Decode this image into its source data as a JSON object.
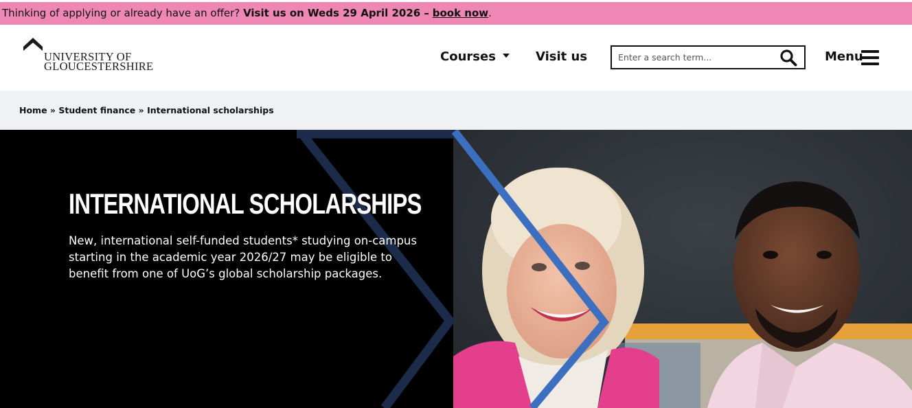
{
  "banner": {
    "lead": "Thinking of applying or already have an offer?",
    "strong": "Visit us on Weds 29 April 2026 –",
    "link": "book now",
    "end": "."
  },
  "logo": {
    "line1": "UNIVERSITY OF",
    "line2": "GLOUCESTERSHIRE"
  },
  "nav": {
    "courses": "Courses",
    "visit": "Visit us",
    "menu": "Menu"
  },
  "search": {
    "placeholder": "Enter a search term..."
  },
  "breadcrumb": {
    "home": "Home",
    "sep": "»",
    "finance": "Student finance",
    "current": "International scholarships"
  },
  "hero": {
    "title": "INTERNATIONAL SCHOLARSHIPS",
    "text": "New, international self-funded students* studying on-campus starting in the academic year 2026/27 may be eligible to benefit from one of UoG’s global scholarship packages."
  },
  "colors": {
    "banner": "#ef87b5",
    "accent_blue": "#3d6fc0",
    "navy": "#1c2b4a"
  }
}
